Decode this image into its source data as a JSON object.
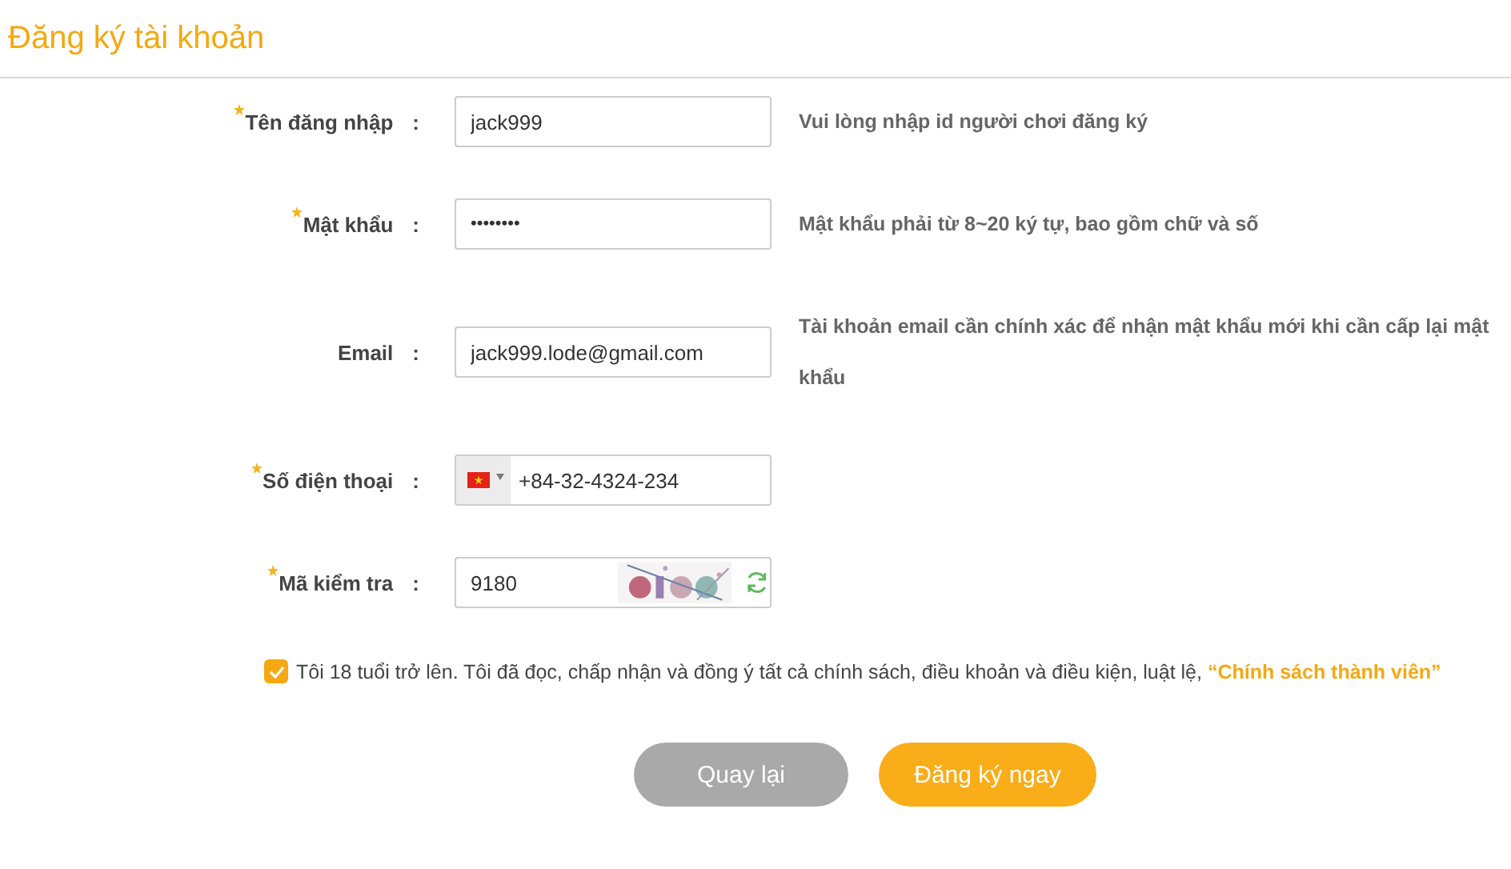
{
  "title": "Đăng ký tài khoản",
  "fields": [
    {
      "kind": "text",
      "label": "Tên đăng nhập",
      "required": true,
      "separator": ":",
      "value": "jack999",
      "hint": "Vui lòng nhập id người chơi đăng ký"
    },
    {
      "kind": "password",
      "label": "Mật khẩu",
      "required": true,
      "separator": ":",
      "value": "••••••••",
      "hint": "Mật khẩu phải từ 8~20 ký tự, bao gồm chữ và số"
    },
    {
      "kind": "text",
      "label": "Email",
      "required": false,
      "separator": ":",
      "value": "jack999.lode@gmail.com",
      "hint": "Tài khoản email cần chính xác để nhận mật khẩu mới khi cần cấp lại mật khẩu"
    },
    {
      "kind": "phone",
      "label": "Số điện thoại",
      "required": true,
      "separator": ":",
      "value": "+84-32-4324-234"
    },
    {
      "kind": "captcha",
      "label": "Mã kiểm tra",
      "required": true,
      "separator": ":",
      "value": "9180"
    }
  ],
  "agreement": {
    "checked": true,
    "text": "Tôi 18 tuổi trở lên. Tôi đã đọc, chấp nhận và đồng ý tất cả chính sách, điều khoản và điều kiện, luật lệ,",
    "link": "“Chính sách thành viên”"
  },
  "buttons": [
    {
      "kind": "secondary",
      "label": "Quay lại"
    },
    {
      "kind": "primary",
      "label": "Đăng ký ngay"
    }
  ]
}
